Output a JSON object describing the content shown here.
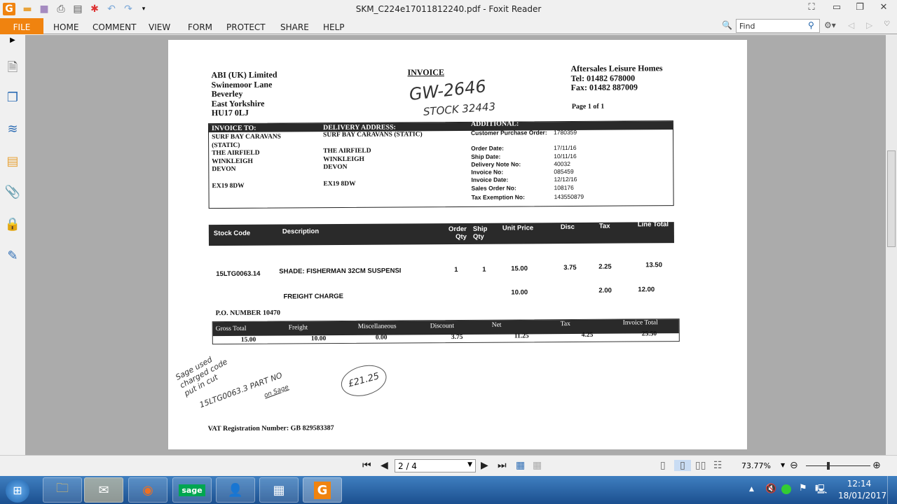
{
  "window": {
    "title": "SKM_C224e17011812240.pdf - Foxit Reader"
  },
  "ribbon": {
    "file": "FILE",
    "tabs": [
      "HOME",
      "COMMENT",
      "VIEW",
      "FORM",
      "PROTECT",
      "SHARE",
      "HELP"
    ],
    "find_placeholder": "Find"
  },
  "invoice": {
    "seller": [
      "ABI (UK) Limited",
      "Swinemoor Lane",
      "Beverley",
      "East Yorkshire",
      "HU17 0LJ"
    ],
    "title": "INVOICE",
    "handwritten_ref": "GW-2646",
    "handwritten_stock": "STOCK 32443",
    "customer": [
      "Aftersales Leisure Homes",
      "Tel: 01482 678000",
      "Fax: 01482 887009"
    ],
    "page": "Page 1 of 1",
    "invoice_to_label": "INVOICE TO:",
    "invoice_to": [
      "SURF BAY CARAVANS",
      "(STATIC)",
      "THE AIRFIELD",
      "WINKLEIGH",
      "DEVON",
      "",
      "EX19 8DW"
    ],
    "delivery_label": "DELIVERY ADDRESS:",
    "delivery": [
      "SURF BAY CARAVANS (STATIC)",
      "",
      "THE AIRFIELD",
      "WINKLEIGH",
      "DEVON",
      "",
      "EX19 8DW"
    ],
    "additional_label": "ADDITIONAL:",
    "additional": [
      {
        "k": "Customer Purchase Order:",
        "v": "1780359"
      },
      {
        "k": "Order Date:",
        "v": "17/11/16"
      },
      {
        "k": "Ship Date:",
        "v": "10/11/16"
      },
      {
        "k": "Delivery Note No:",
        "v": "40032"
      },
      {
        "k": "Invoice No:",
        "v": "085459"
      },
      {
        "k": "Invoice Date:",
        "v": "12/12/16"
      },
      {
        "k": "Sales Order No:",
        "v": "108176"
      },
      {
        "k": "Tax Exemption No:",
        "v": "143550879"
      }
    ],
    "columns": [
      "Stock Code",
      "Description",
      "Order Qty",
      "Ship Qty",
      "Unit Price",
      "Disc",
      "Tax",
      "Line Total"
    ],
    "lines": [
      {
        "code": "15LTG0063.14",
        "desc": "SHADE: FISHERMAN 32CM SUSPENSI",
        "oqty": "1",
        "sqty": "1",
        "price": "15.00",
        "disc": "3.75",
        "tax": "2.25",
        "total": "13.50"
      },
      {
        "code": "",
        "desc": "FREIGHT CHARGE",
        "oqty": "",
        "sqty": "",
        "price": "10.00",
        "disc": "",
        "tax": "2.00",
        "total": "12.00"
      }
    ],
    "po": "P.O. NUMBER 10470",
    "totals_headers": [
      "Gross Total",
      "Freight",
      "Miscellaneous",
      "Discount",
      "Net",
      "Tax",
      "Invoice Total"
    ],
    "totals": [
      "15.00",
      "10.00",
      "0.00",
      "3.75",
      "11.25",
      "4.25",
      "25.50"
    ],
    "notes": [
      "Sage used",
      "charged code",
      "put in cut",
      "15LTG0063.3 PART NO",
      "on Sage"
    ],
    "circled": "£21.25",
    "vat": "VAT Registration Number: GB 829583387"
  },
  "status": {
    "page": "2 / 4",
    "zoom": "73.77%"
  },
  "taskbar": {
    "time": "12:14",
    "date": "18/01/2017",
    "sage": "sage"
  }
}
